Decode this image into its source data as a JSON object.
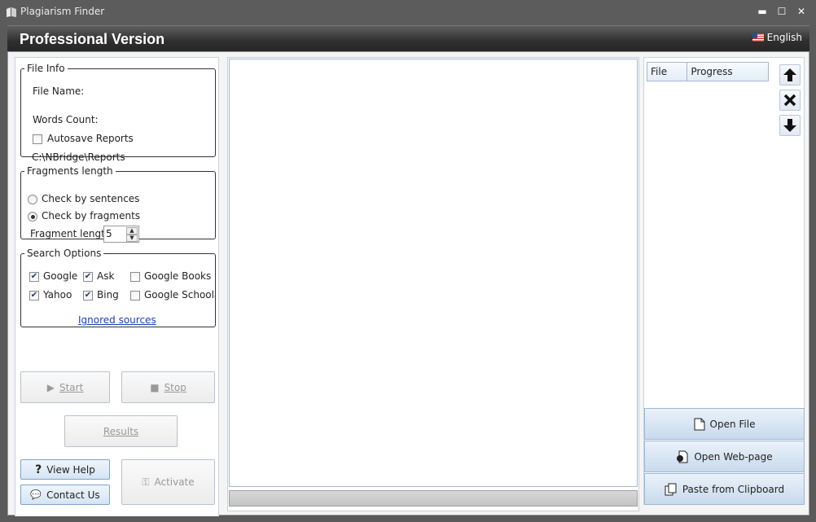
{
  "window": {
    "title": "Plagiarism Finder",
    "controls": {
      "minimize": "▬",
      "maximize": "☐",
      "close": "✕"
    }
  },
  "header": {
    "version_label": "Professional Version",
    "language": "English"
  },
  "file_info": {
    "legend": "File Info",
    "file_name_label": "File Name:",
    "words_count_label": "Words Count:",
    "autosave_label": "Autosave Reports",
    "autosave_checked": false,
    "reports_path": "C:\\NBridge\\Reports"
  },
  "fragments": {
    "legend": "Fragments length",
    "by_sentences_label": "Check by sentences",
    "by_fragments_label": "Check by fragments",
    "selected": "fragments",
    "fragment_length_label": "Fragment length:",
    "fragment_length_value": "5"
  },
  "search_options": {
    "legend": "Search Options",
    "engines": [
      {
        "label": "Google",
        "checked": true
      },
      {
        "label": "Ask",
        "checked": true
      },
      {
        "label": "Google Books",
        "checked": false
      },
      {
        "label": "Yahoo",
        "checked": true
      },
      {
        "label": "Bing",
        "checked": true
      },
      {
        "label": "Google Schoolar",
        "checked": false
      }
    ],
    "ignored_sources_label": "Ignored sources"
  },
  "actions": {
    "start_label": "Start",
    "stop_label": "Stop",
    "results_label": "Results",
    "view_help_label": "View Help",
    "contact_us_label": "Contact Us",
    "activate_label": "Activate"
  },
  "queue": {
    "columns": [
      "File",
      "Progress"
    ],
    "open_file_label": "Open File",
    "open_webpage_label": "Open Web-page",
    "paste_label": "Paste from Clipboard"
  },
  "colors": {
    "accent": "#1c3fb8",
    "header_bg": "#2f2f2f"
  }
}
